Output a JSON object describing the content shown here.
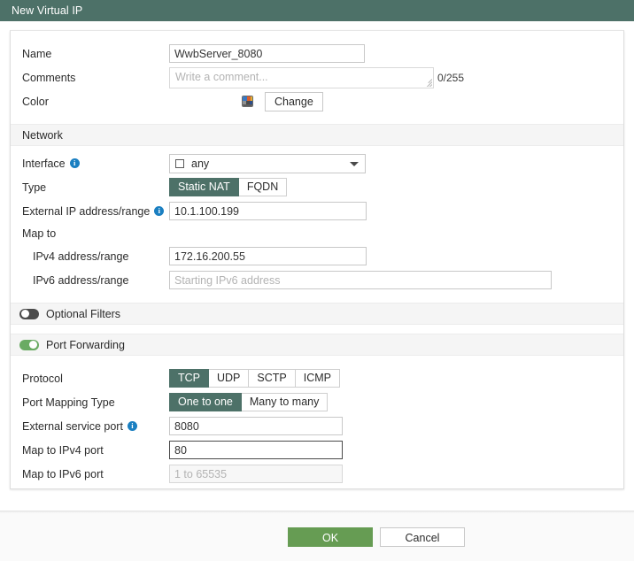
{
  "window": {
    "title": "New Virtual IP"
  },
  "general": {
    "name_label": "Name",
    "name_value": "WwbServer_8080",
    "comments_label": "Comments",
    "comments_placeholder": "Write a comment...",
    "comments_counter": "0/255",
    "color_label": "Color",
    "color_change_button": "Change"
  },
  "network": {
    "section_title": "Network",
    "interface_label": "Interface",
    "interface_value": "any",
    "type_label": "Type",
    "type_options": [
      "Static NAT",
      "FQDN"
    ],
    "type_selected": "Static NAT",
    "external_ip_label": "External IP address/range",
    "external_ip_value": "10.1.100.199",
    "map_to_label": "Map to",
    "ipv4_label": "IPv4 address/range",
    "ipv4_value": "172.16.200.55",
    "ipv6_label": "IPv6 address/range",
    "ipv6_placeholder": "Starting IPv6 address",
    "ipv6_value": ""
  },
  "optional_filters": {
    "label": "Optional Filters",
    "enabled": "off"
  },
  "port_forwarding": {
    "label": "Port Forwarding",
    "enabled": "on",
    "protocol_label": "Protocol",
    "protocol_options": [
      "TCP",
      "UDP",
      "SCTP",
      "ICMP"
    ],
    "protocol_selected": "TCP",
    "mapping_type_label": "Port Mapping Type",
    "mapping_type_options": [
      "One to one",
      "Many to many"
    ],
    "mapping_type_selected": "One to one",
    "external_service_port_label": "External service port",
    "external_service_port_value": "8080",
    "map_ipv4_port_label": "Map to IPv4 port",
    "map_ipv4_port_value": "80",
    "map_ipv6_port_label": "Map to IPv6 port",
    "map_ipv6_port_placeholder": "1 to 65535",
    "map_ipv6_port_value": ""
  },
  "footer": {
    "ok_label": "OK",
    "cancel_label": "Cancel"
  },
  "colors": {
    "header_teal": "#4d7168",
    "accent_selected": "#4d7168",
    "ok_green": "#669c53",
    "toggle_on_green": "#6aab63",
    "info_blue": "#1a7fc1"
  }
}
